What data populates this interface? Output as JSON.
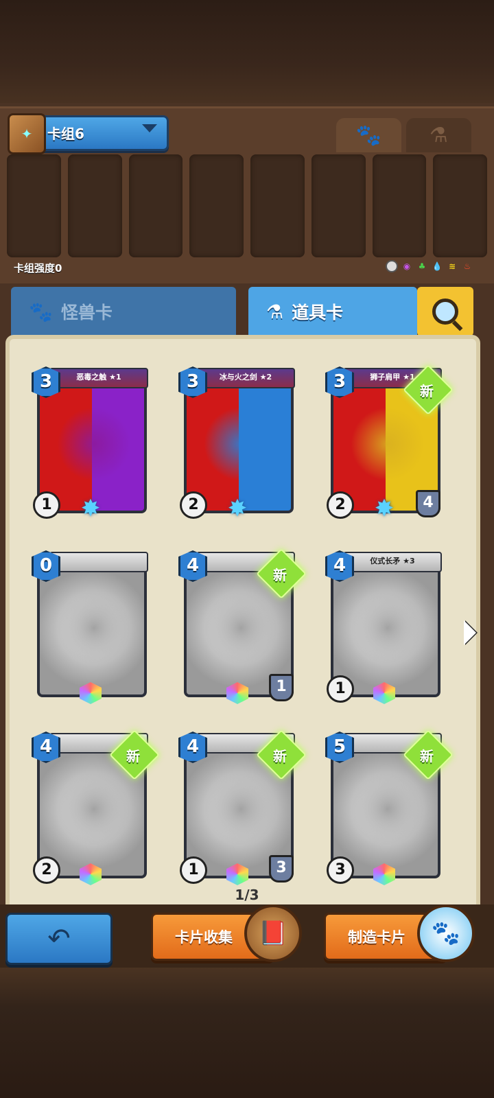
{
  "deck": {
    "name": "卡组6",
    "strength_label": "卡组强度0"
  },
  "element_icons": [
    "neutral",
    "dark",
    "nature",
    "water",
    "wind",
    "fire"
  ],
  "tabs": {
    "monster": "怪兽卡",
    "item": "道具卡"
  },
  "cards": [
    {
      "name": "恶毒之触 ★1",
      "cost": "3",
      "atk": "1",
      "def": "",
      "new": false,
      "art": "#8c1a9c"
    },
    {
      "name": "冰与火之剑 ★2",
      "cost": "3",
      "atk": "2",
      "def": "",
      "new": false,
      "art": "#2a7fd6"
    },
    {
      "name": "狮子肩甲 ★1",
      "cost": "3",
      "atk": "2",
      "def": "4",
      "new": true,
      "new_label": "新",
      "art": "#d9b020"
    },
    {
      "name": "",
      "cost": "0",
      "atk": "",
      "def": "",
      "new": false,
      "art": "#9a9a9a"
    },
    {
      "name": "",
      "cost": "4",
      "atk": "",
      "def": "1",
      "new": true,
      "new_label": "新",
      "art": "#9a9a9a"
    },
    {
      "name": "仪式长矛 ★3",
      "cost": "4",
      "atk": "1",
      "def": "",
      "new": false,
      "art": "#9a9a9a"
    },
    {
      "name": "",
      "cost": "4",
      "atk": "2",
      "def": "",
      "new": true,
      "new_label": "新",
      "art": "#9a9a9a"
    },
    {
      "name": "",
      "cost": "4",
      "atk": "1",
      "def": "3",
      "new": true,
      "new_label": "新",
      "art": "#9a9a9a"
    },
    {
      "name": "",
      "cost": "5",
      "atk": "3",
      "def": "",
      "new": true,
      "new_label": "新",
      "art": "#9a9a9a"
    }
  ],
  "pager": "1/3",
  "buttons": {
    "collect": "卡片收集",
    "craft": "制造卡片"
  }
}
